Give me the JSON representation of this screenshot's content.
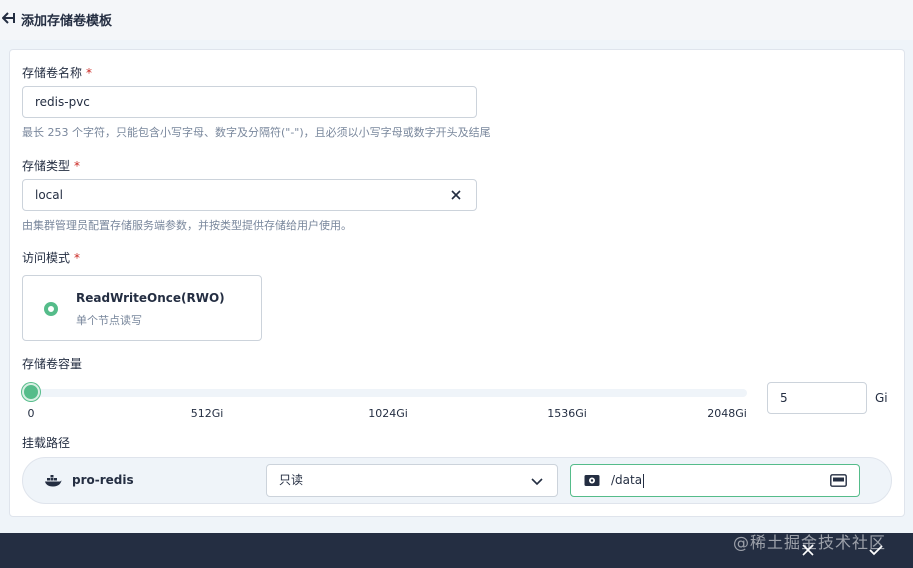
{
  "header": {
    "title": "添加存储卷模板"
  },
  "name_field": {
    "label": "存储卷名称",
    "required_mark": "*",
    "value": "redis-pvc",
    "hint": "最长 253 个字符，只能包含小写字母、数字及分隔符(\"-\")，且必须以小写字母或数字开头及结尾"
  },
  "storage_class": {
    "label": "存储类型",
    "required_mark": "*",
    "value": "local",
    "hint": "由集群管理员配置存储服务端参数，并按类型提供存储给用户使用。"
  },
  "access_mode": {
    "label": "访问模式",
    "required_mark": "*",
    "option_title": "ReadWriteOnce(RWO)",
    "option_desc": "单个节点读写",
    "selected": true
  },
  "capacity": {
    "label": "存储卷容量",
    "ticks": [
      "0",
      "512Gi",
      "1024Gi",
      "1536Gi",
      "2048Gi"
    ],
    "slider_value": 5,
    "slider_max": 2048,
    "value": "5",
    "unit": "Gi"
  },
  "mount": {
    "label": "挂载路径",
    "container_name": "pro-redis",
    "mode_value": "只读",
    "path_value": "/data"
  },
  "footer": {
    "watermark": "@稀土掘金技术社区"
  },
  "colors": {
    "accent": "#55bc8a",
    "text": "#242e42",
    "muted": "#79879c",
    "required": "#ca2621",
    "footer_bg": "#242e42"
  },
  "icons": {
    "back": "back-arrow-icon",
    "clear": "close-icon",
    "container": "docker-icon",
    "dropdown": "chevron-down-icon",
    "volume": "disk-icon",
    "keyboard": "keyboard-icon",
    "cancel": "close-icon",
    "confirm": "check-icon"
  }
}
